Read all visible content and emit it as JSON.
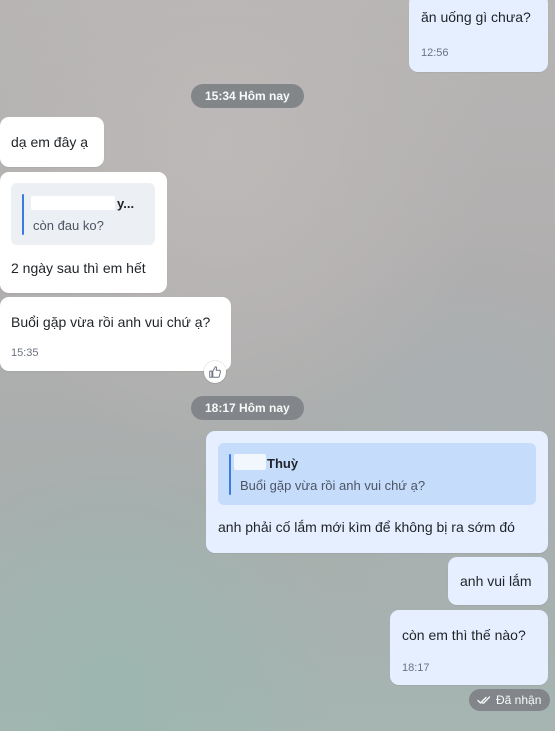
{
  "messages": {
    "m1": {
      "text": "ăn uống gì chưa?",
      "time": "12:56"
    },
    "divider1": "15:34 Hôm nay",
    "m2": {
      "text": "dạ em đây ạ"
    },
    "m3": {
      "quote_name": "y...",
      "quote_text": "còn đau ko?",
      "text": "2 ngày sau thì em hết"
    },
    "m4": {
      "text": "Buổi gặp vừa rồi anh vui chứ ạ?",
      "time": "15:35",
      "reaction_icon": "thumbs-up-icon"
    },
    "divider2": "18:17 Hôm nay",
    "m5": {
      "quote_name": "Thuỳ",
      "quote_text": "Buổi gặp vừa rồi anh vui chứ ạ?",
      "text": "anh phải cố lắm mới kìm để không bị ra sớm đó"
    },
    "m6": {
      "text": "anh vui lắm"
    },
    "m7": {
      "text": "còn em thì thế nào?",
      "time": "18:17"
    }
  },
  "status": {
    "label": "Đã nhận",
    "icon": "double-check-icon"
  },
  "colors": {
    "outgoing": "#e5efff",
    "incoming": "#ffffff",
    "quote_bar": "#3a7be0",
    "pill": "#7f8286"
  }
}
